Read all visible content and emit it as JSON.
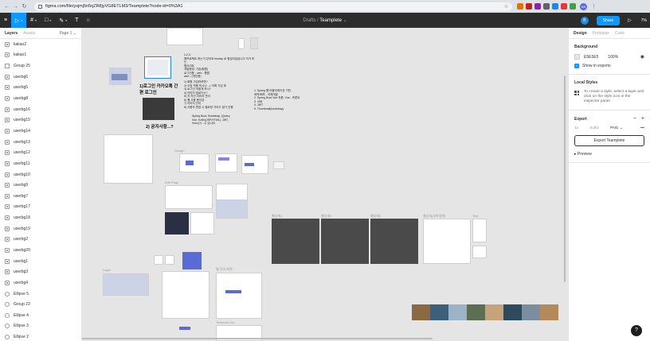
{
  "browser": {
    "url": "figma.com/file/ysjmj5n5qZR8jyVG8ETLM3/Teamplete?node-id=0%3A1",
    "extensions": [
      "#e37400",
      "#c5221f",
      "#8e24aa",
      "#5f6368",
      "#1e88e5",
      "#e53935",
      "#43a047"
    ],
    "profile_initials": "B9"
  },
  "toolbar": {
    "breadcrumb_parent": "Drafts",
    "separator": "/",
    "file_name": "Teamplete",
    "file_caret": "⌄",
    "avatar_initial": "B",
    "share_label": "Share",
    "zoom_label": "7%"
  },
  "left_panel": {
    "tabs": [
      "Layers",
      "Assets"
    ],
    "page_label": "Page 1 ⌄",
    "layers": [
      {
        "name": "kakao2",
        "type": "img"
      },
      {
        "name": "kakao1",
        "type": "img"
      },
      {
        "name": "Group 25",
        "type": "group"
      },
      {
        "name": "userbg6",
        "type": "img"
      },
      {
        "name": "userbg5",
        "type": "img"
      },
      {
        "name": "userbg8",
        "type": "img"
      },
      {
        "name": "userbg16",
        "type": "img"
      },
      {
        "name": "userbg15",
        "type": "img"
      },
      {
        "name": "userbg14",
        "type": "img"
      },
      {
        "name": "userbg13",
        "type": "img"
      },
      {
        "name": "userbg12",
        "type": "img"
      },
      {
        "name": "userbg11",
        "type": "img"
      },
      {
        "name": "userbg10",
        "type": "img"
      },
      {
        "name": "userbg9",
        "type": "img"
      },
      {
        "name": "userbg7",
        "type": "img"
      },
      {
        "name": "userbg17",
        "type": "img"
      },
      {
        "name": "userbg18",
        "type": "img"
      },
      {
        "name": "userbg19",
        "type": "img"
      },
      {
        "name": "userbg2",
        "type": "img"
      },
      {
        "name": "userbg20",
        "type": "img"
      },
      {
        "name": "userbg1",
        "type": "img"
      },
      {
        "name": "userbg3",
        "type": "img"
      },
      {
        "name": "userbg4",
        "type": "img"
      },
      {
        "name": "Ellipse 5",
        "type": "circle"
      },
      {
        "name": "Group 22",
        "type": "circle"
      },
      {
        "name": "Ellipse 4",
        "type": "circle"
      },
      {
        "name": "Ellipse 3",
        "type": "circle"
      },
      {
        "name": "Ellipse 2",
        "type": "circle"
      }
    ]
  },
  "canvas": {
    "ko_title_1": "1)로그인 카카오톡 간편 로그인",
    "ko_title_2": "2) 공지사항...?",
    "text_main": "1,2,3,\n웹프로젝트 하는거 있어요 bootap 로 형성되었습니다 이거 하는\n웹사이트\n개발환경: 기존(회원)\n로그인용 - web - 웹앱\nweb - (개인용)",
    "text_questions": "1) 회원 가입하려면?\n2) 오징 적용 하시나 --> 카톡 가입 후\n3) 로그인 어떻게 하나?\n4) 이미지 업로드는?\n5) 지 자신 이미지 관리\n6) 웹 사용 용이성\n7) 이미지 관리\n8) 사용자 변경 시 필요한 가이드 찾기 진행",
    "text_stack": "Spring Boot, Bootstrap, jQuery,\nVue, Kotlin(JSP/HTML), JWT,\nVuex(?) - 수 있나요",
    "text_list": "1. Spring 웹 어플리케이션 기반,\n제작/배포 - 자체개발\n2. Spring Boot Vue 적용, Vue - 프론트\n3. 서버\n4. JWT\n5. Thumbnail(bootstrap)",
    "label_design": "Design",
    "label_editpage": "Edit Page",
    "label_login": "Login",
    "label_w1": "웹상세1",
    "label_w2": "웹상세2",
    "label_w3": "웹상세3",
    "label_w4": "웹상세(모바일형)",
    "label_test": "Test",
    "label_tag": "웹 작업 화면",
    "label_textbook": "Textbook List",
    "help": "?"
  },
  "right_panel": {
    "tabs": [
      "Design",
      "Prototype",
      "Code"
    ],
    "background_heading": "Background",
    "bg_hex": "E5E5E5",
    "bg_opacity": "100%",
    "show_in_exports": "Show in exports",
    "local_styles_heading": "Local Styles",
    "local_styles_text": "To create a style, select a layer and click on the style icon in the inspector panel.",
    "export_heading": "Export",
    "export_minus": "−",
    "export_plus": "+",
    "export_scale": "1x",
    "export_suffix": "Suffix",
    "export_format": "PNG ⌄",
    "export_more": "•••",
    "export_button": "Export Teamplete",
    "preview_label": "Preview"
  }
}
